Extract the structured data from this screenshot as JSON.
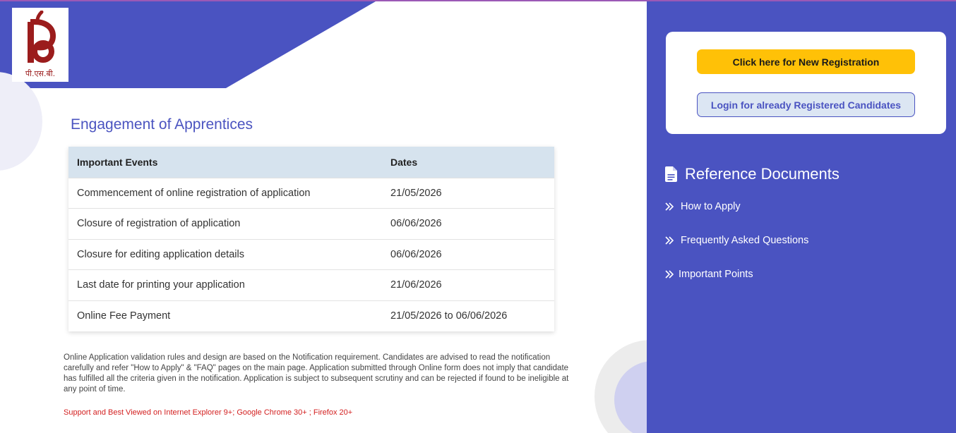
{
  "header": {
    "logo_caption": "पी.एस.बी."
  },
  "main": {
    "title": "Engagement of Apprentices",
    "table": {
      "headers": [
        "Important Events",
        "Dates"
      ],
      "rows": [
        [
          "Commencement of online registration of application",
          "21/05/2026"
        ],
        [
          "Closure of registration of application",
          "06/06/2026"
        ],
        [
          "Closure for editing application details",
          "06/06/2026"
        ],
        [
          "Last date for printing your application",
          "21/06/2026"
        ],
        [
          "Online Fee Payment",
          "21/05/2026 to 06/06/2026"
        ]
      ]
    },
    "disclaimer": "Online Application validation rules and design are based on the Notification requirement. Candidates are advised to read the notification carefully and refer \"How to Apply\" & \"FAQ\" pages on the main page. Application submitted through Online form does not imply that candidate has fulfilled all the criteria given in the notification. Application is subject to subsequent scrutiny and can be rejected if found to be ineligible at any point of time.",
    "support_note": "Support and Best Viewed on Internet Explorer 9+; Google Chrome 30+ ; Firefox 20+"
  },
  "sidebar": {
    "register_label": "Click here for New Registration",
    "login_label": "Login for already Registered Candidates",
    "reference_title": "Reference Documents",
    "reference_icon": "document-icon",
    "links": [
      {
        "label": "How to Apply",
        "icon": "double-chevron-right-icon"
      },
      {
        "label": "Frequently Asked Questions",
        "icon": "double-chevron-right-icon"
      },
      {
        "label": "Important Points",
        "icon": "double-chevron-right-icon"
      }
    ]
  },
  "colors": {
    "primary": "#4a53c1",
    "register_button": "#ffc107",
    "table_header": "#d6e3ee",
    "logo_red": "#9b1c1c",
    "support_note": "#d32020"
  }
}
